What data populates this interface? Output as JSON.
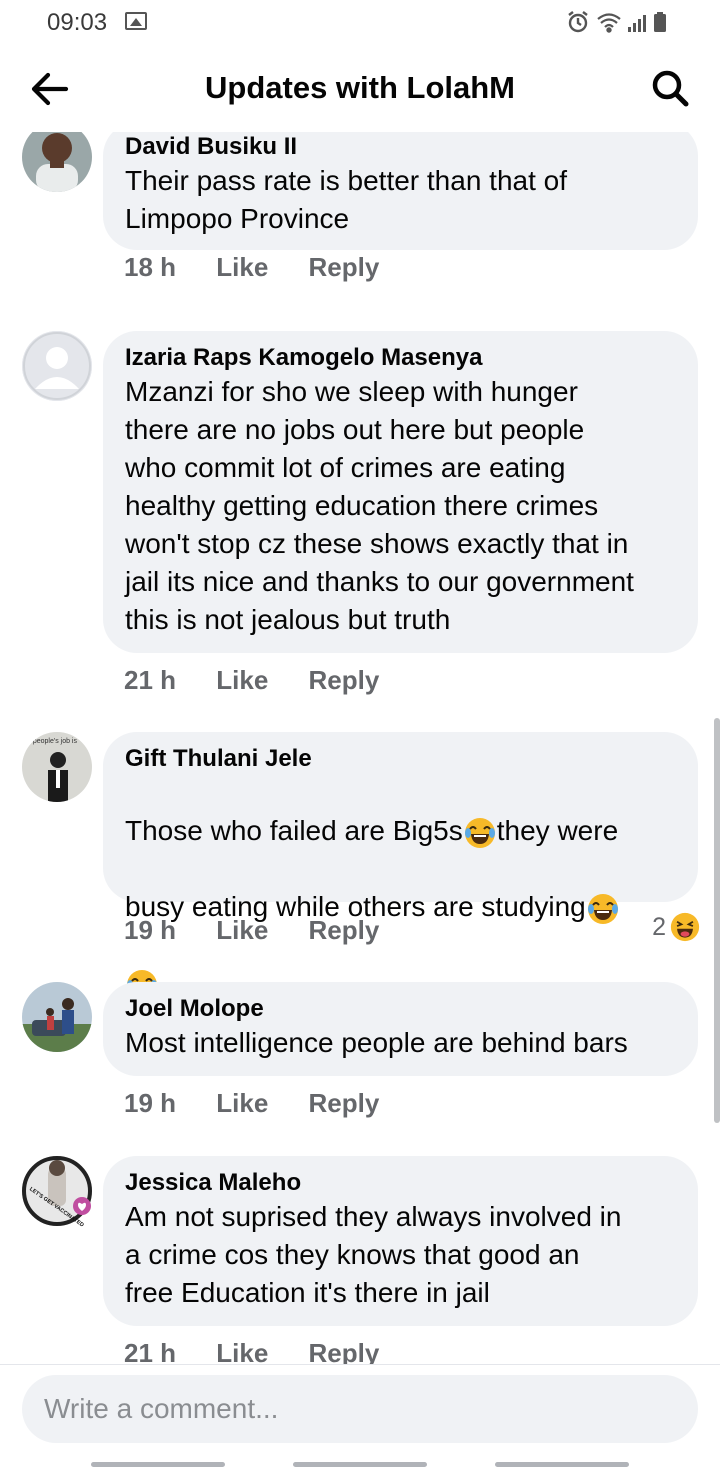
{
  "status_bar": {
    "time": "09:03"
  },
  "header": {
    "title": "Updates with LolahM"
  },
  "comments": [
    {
      "author": "David Busiku II",
      "text": "Their pass rate is better than that of\nLimpopo Province",
      "time": "18 h",
      "like": "Like",
      "reply": "Reply"
    },
    {
      "author": "Izaria Raps Kamogelo Masenya",
      "text": "Mzanzi for sho we sleep with hunger\nthere are no jobs out here but people\nwho commit lot of crimes are eating\nhealthy getting education there crimes\nwon't stop cz these shows exactly that in\njail its nice and thanks to our government\nthis is not jealous but truth",
      "time": "21 h",
      "like": "Like",
      "reply": "Reply"
    },
    {
      "author": "Gift Thulani Jele",
      "text_part1": "Those who failed are Big5s",
      "text_part2": "they were",
      "text_part3": "busy eating while others are studying",
      "time": "19 h",
      "like": "Like",
      "reply": "Reply",
      "reaction_count": "2",
      "avatar_caption": "a people's job is"
    },
    {
      "author": "Joel Molope",
      "text": "Most intelligence people are behind bars",
      "time": "19 h",
      "like": "Like",
      "reply": "Reply"
    },
    {
      "author": "Jessica Maleho",
      "text": "Am not suprised they always involved in\na crime cos they knows that good an\nfree Education it's there in jail",
      "time": "21 h",
      "like": "Like",
      "reply": "Reply",
      "avatar_badge": "LET'S GET VACCINATED"
    }
  ],
  "composer": {
    "placeholder": "Write a comment..."
  },
  "colors": {
    "bubble": "#f0f2f5",
    "meta_text": "#65676b",
    "emoji_face": "#f7b928"
  }
}
